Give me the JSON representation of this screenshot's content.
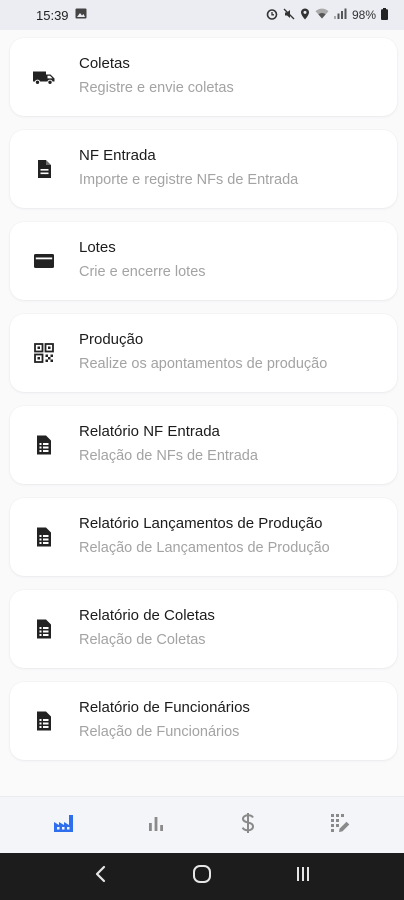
{
  "status_bar": {
    "time": "15:39",
    "battery": "98%",
    "icons": [
      "image-icon",
      "alarm-icon",
      "mute-icon",
      "location-icon",
      "wifi-icon",
      "signal-icon",
      "battery-icon"
    ]
  },
  "menu": {
    "items": [
      {
        "title": "Coletas",
        "subtitle": "Registre e envie coletas",
        "icon": "truck-icon"
      },
      {
        "title": "NF Entrada",
        "subtitle": "Importe e registre NFs de Entrada",
        "icon": "document-icon"
      },
      {
        "title": "Lotes",
        "subtitle": "Crie e encerre lotes",
        "icon": "card-icon"
      },
      {
        "title": "Produção",
        "subtitle": "Realize os apontamentos de produção",
        "icon": "qr-code-icon"
      },
      {
        "title": "Relatório NF Entrada",
        "subtitle": "Relação de NFs de Entrada",
        "icon": "report-icon"
      },
      {
        "title": "Relatório Lançamentos de Produção",
        "subtitle": "Relação de Lançamentos de Produção",
        "icon": "report-icon"
      },
      {
        "title": "Relatório de Coletas",
        "subtitle": "Relação de Coletas",
        "icon": "report-icon"
      },
      {
        "title": "Relatório de Funcionários",
        "subtitle": "Relação de Funcionários",
        "icon": "report-icon"
      }
    ]
  },
  "tab_bar": {
    "active_color": "#2f6fed",
    "inactive_color": "#8a8a8a",
    "tabs": [
      {
        "icon": "factory-icon",
        "active": true
      },
      {
        "icon": "bar-chart-icon",
        "active": false
      },
      {
        "icon": "dollar-icon",
        "active": false
      },
      {
        "icon": "edit-grid-icon",
        "active": false
      }
    ]
  },
  "nav_bar": {
    "buttons": [
      {
        "icon": "back-icon"
      },
      {
        "icon": "home-icon"
      },
      {
        "icon": "recents-icon"
      }
    ]
  }
}
